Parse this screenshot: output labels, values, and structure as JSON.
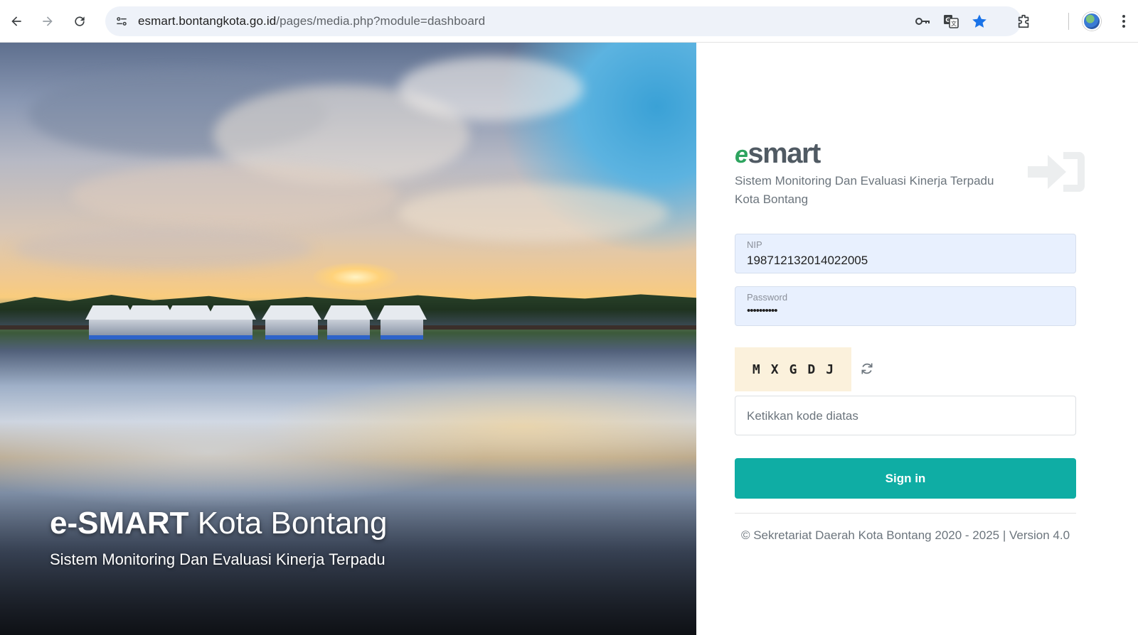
{
  "browser": {
    "url_host": "esmart.bontangkota.go.id",
    "url_path": "/pages/media.php?module=dashboard",
    "icons": [
      "back-icon",
      "forward-icon",
      "reload-icon",
      "site-info-icon",
      "password-key-icon",
      "translate-icon",
      "bookmark-star-icon",
      "extensions-icon",
      "profile-avatar",
      "more-menu-icon"
    ],
    "star_color": "#1a73e8"
  },
  "hero": {
    "title_bold": "e-SMART",
    "title_rest": " Kota Bontang",
    "subtitle": "Sistem Monitoring Dan Evaluasi Kinerja Terpadu"
  },
  "login": {
    "logo_e": "e",
    "logo_text": "smart",
    "app_subtitle": "Sistem Monitoring Dan Evaluasi Kinerja Terpadu Kota Bontang",
    "nip_label": "NIP",
    "nip_value": "198712132014022005",
    "password_label": "Password",
    "password_value": "••••••••••",
    "captcha_code": "MXGDJ",
    "captcha_placeholder": "Ketikkan kode diatas",
    "signin_label": "Sign in",
    "footer": "© Sekretariat Daerah Kota Bontang 2020 - 2025 | Version 4.0",
    "accent_color": "#0fada4",
    "logo_green": "#2ea45f"
  }
}
